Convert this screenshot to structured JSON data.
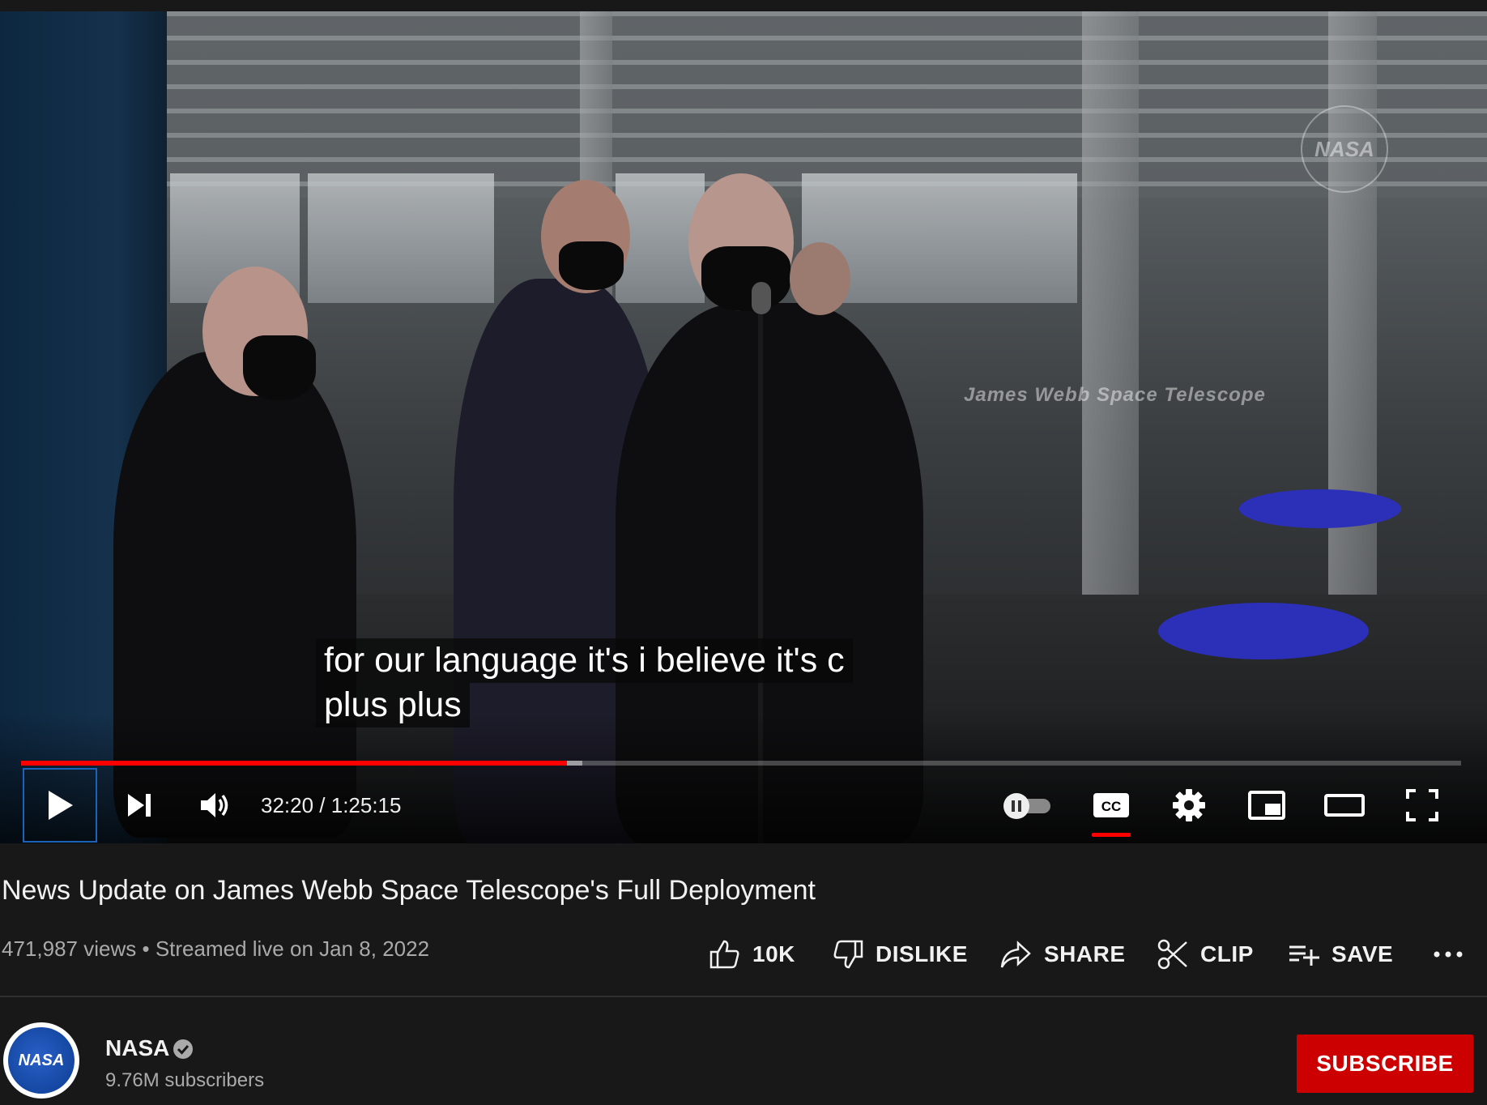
{
  "video": {
    "captions": [
      "for our language it's i believe it's c",
      "plus plus"
    ],
    "watermark_text": "James Webb Space Telescope",
    "watermark_logo": "NASA",
    "progress_played": 0.379,
    "progress_buffered": 0.39,
    "time_display": "32:20 / 1:25:15",
    "autoplay_on": false,
    "captions_on": true
  },
  "title": "News Update on James Webb Space Telescope's Full Deployment",
  "meta": {
    "views": "471,987 views",
    "separator": "•",
    "streamed": "Streamed live on Jan 8, 2022"
  },
  "actions": {
    "like_label": "10K",
    "dislike_label": "DISLIKE",
    "share_label": "SHARE",
    "clip_label": "CLIP",
    "save_label": "SAVE",
    "more_label": "..."
  },
  "channel": {
    "name": "NASA",
    "avatar_text": "NASA",
    "subscribers": "9.76M subscribers",
    "verified": true
  },
  "subscribe_label": "SUBSCRIBE",
  "colors": {
    "background": "#181818",
    "accent_red": "#ff0000",
    "subscribe_red": "#cc0000",
    "focus_blue": "#1c62b9"
  }
}
